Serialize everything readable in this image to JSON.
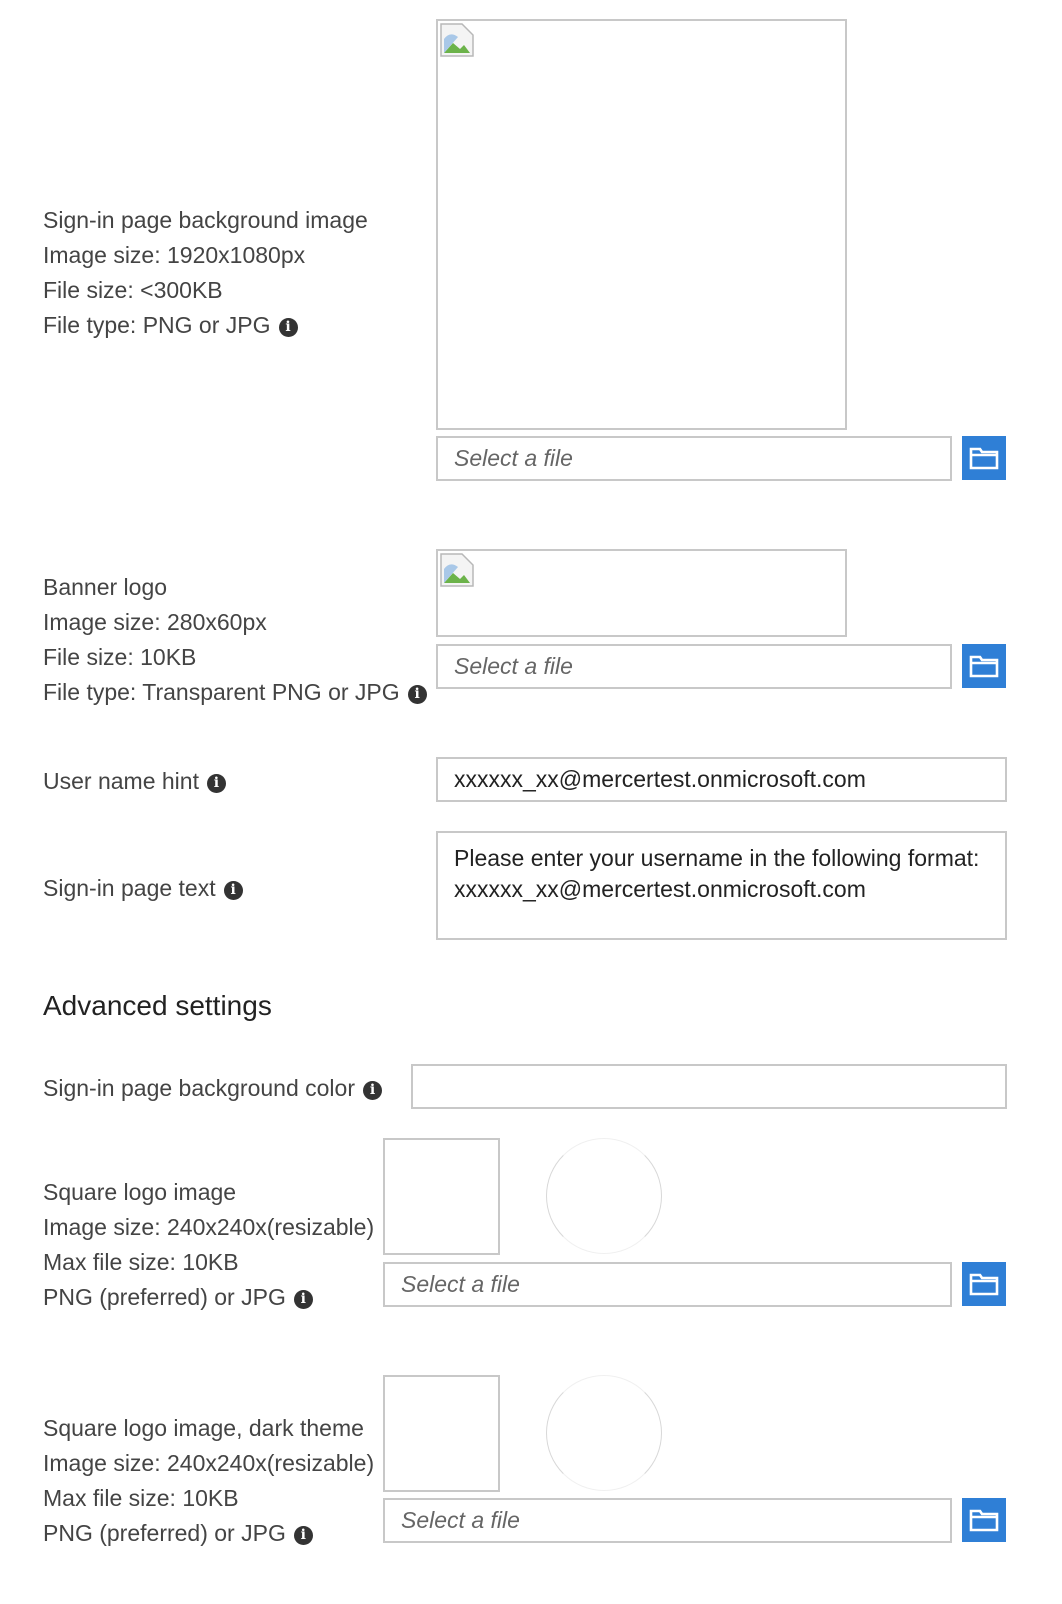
{
  "background_image": {
    "title": "Sign-in page background image",
    "image_size": "Image size: 1920x1080px",
    "file_size": "File size: <300KB",
    "file_type": "File type: PNG or JPG",
    "file_placeholder": "Select a file"
  },
  "banner_logo": {
    "title": "Banner logo",
    "image_size": "Image size: 280x60px",
    "file_size": "File size: 10KB",
    "file_type": "File type: Transparent PNG or JPG",
    "file_placeholder": "Select a file"
  },
  "username_hint": {
    "label": "User name hint",
    "value": "xxxxxx_xx@mercertest.onmicrosoft.com"
  },
  "signin_text": {
    "label": "Sign-in page text",
    "line1": "Please enter your username in the following format:",
    "line2": "xxxxxx_xx@mercertest.onmicrosoft.com"
  },
  "advanced": {
    "heading": "Advanced settings",
    "bg_color_label": "Sign-in page background color",
    "bg_color_value": ""
  },
  "square_logo": {
    "title": "Square logo image",
    "image_size": "Image size: 240x240x(resizable)",
    "file_size": "Max file size: 10KB",
    "file_type": "PNG (preferred) or JPG",
    "file_placeholder": "Select a file"
  },
  "square_logo_dark": {
    "title": "Square logo image, dark theme",
    "image_size": "Image size: 240x240x(resizable)",
    "file_size": "Max file size: 10KB",
    "file_type": "PNG (preferred) or JPG",
    "file_placeholder": "Select a file"
  },
  "icons": {
    "info": "info-icon",
    "browse": "folder-icon",
    "broken_image": "broken-image-icon"
  },
  "colors": {
    "accent": "#2f7fd6",
    "border": "#c8c8c8",
    "text": "#444444"
  }
}
